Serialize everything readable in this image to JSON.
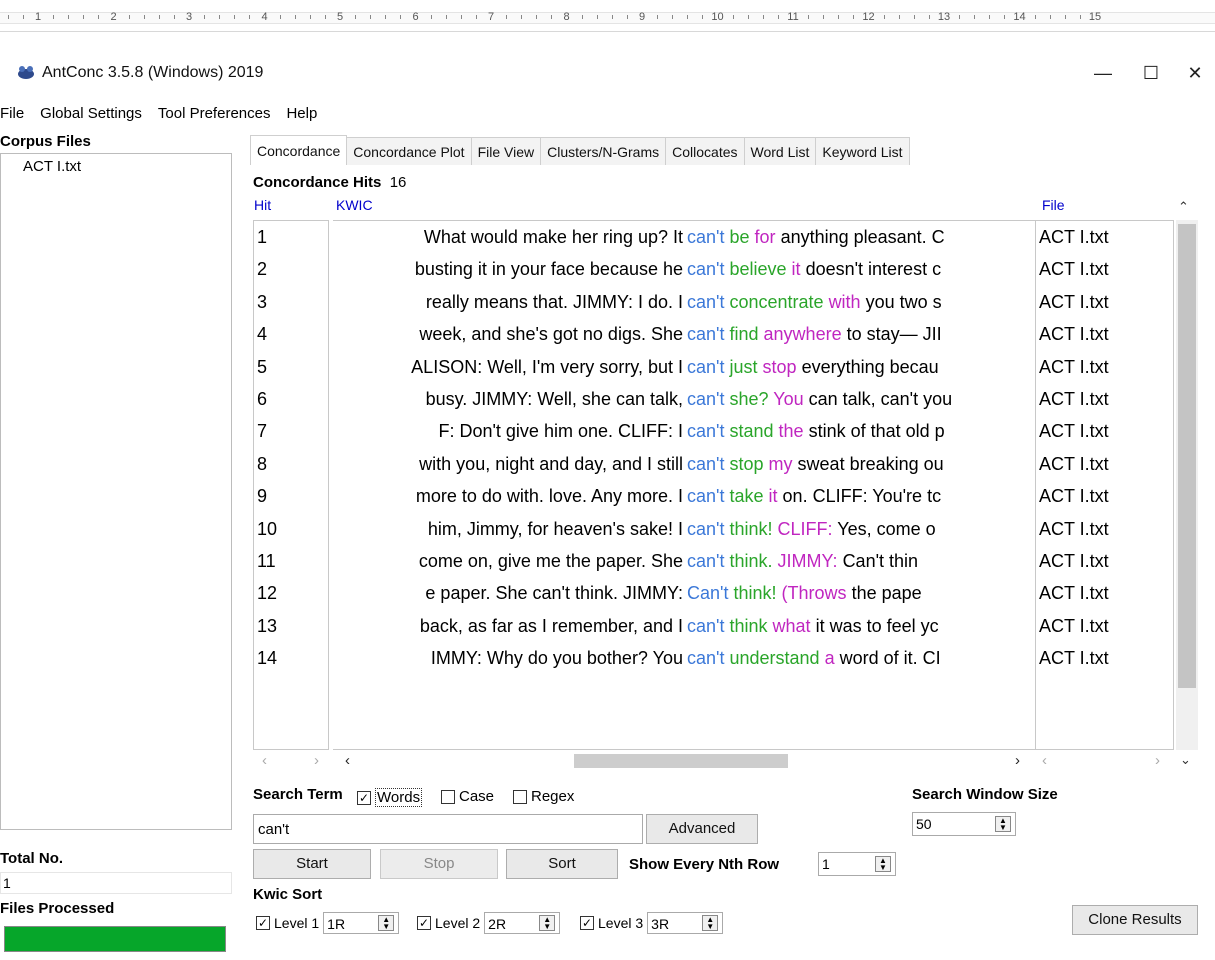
{
  "ruler": {
    "numbers": [
      "1",
      "2",
      "3",
      "4",
      "5",
      "6",
      "7",
      "8",
      "9",
      "10",
      "11",
      "12",
      "13",
      "14",
      "15"
    ]
  },
  "window": {
    "title": "AntConc 3.5.8 (Windows) 2019",
    "minimize": "—",
    "maximize": "☐",
    "close": "✕"
  },
  "menu": {
    "items": [
      "File",
      "Global Settings",
      "Tool Preferences",
      "Help"
    ]
  },
  "sidebar": {
    "corpus_label": "Corpus Files",
    "files": [
      "ACT I.txt"
    ],
    "total_label": "Total No.",
    "total_value": "1",
    "files_processed_label": "Files Processed",
    "progress": 1.0
  },
  "tabs": [
    "Concordance",
    "Concordance Plot",
    "File View",
    "Clusters/N-Grams",
    "Collocates",
    "Word List",
    "Keyword List"
  ],
  "concordance": {
    "hits_label": "Concordance Hits",
    "hits_count": "16",
    "col_hit": "Hit",
    "col_kwic": "KWIC",
    "col_file": "File",
    "rows": [
      {
        "hit": "1",
        "left": "What would make her ring up? It",
        "kw": "can't",
        "r1": "be",
        "r2": "for",
        "rest": "anything pleasant. C",
        "file": "ACT I.txt"
      },
      {
        "hit": "2",
        "left": "busting it in your face because he",
        "kw": "can't",
        "r1": "believe",
        "r2": "it",
        "rest": "doesn't interest c",
        "file": "ACT I.txt"
      },
      {
        "hit": "3",
        "left": "really means that. JIMMY: I    do. I",
        "kw": "can't",
        "r1": "concentrate",
        "r2": "with",
        "rest": "you two s",
        "file": "ACT I.txt"
      },
      {
        "hit": "4",
        "left": "week, and she's got no digs. She",
        "kw": "can't",
        "r1": "find",
        "r2": "anywhere",
        "rest": "to stay— JII",
        "file": "ACT I.txt"
      },
      {
        "hit": "5",
        "left": "ALISON: Well, I'm very sorry, but I",
        "kw": "can't",
        "r1": "just",
        "r2": "stop",
        "rest": "everything becau",
        "file": "ACT I.txt"
      },
      {
        "hit": "6",
        "left": "busy. JIMMY: Well, she can talk,",
        "kw": "can't",
        "r1": "she?",
        "r2": "You",
        "rest": "can talk, can't you",
        "file": "ACT I.txt"
      },
      {
        "hit": "7",
        "left": "F: Don't    give him one. CLIFF: I",
        "kw": "can't",
        "r1": "stand",
        "r2": "the",
        "rest": "stink of that old p",
        "file": "ACT I.txt"
      },
      {
        "hit": "8",
        "left": "with you, night and day, and I still",
        "kw": "can't",
        "r1": "stop",
        "r2": "my",
        "rest": "sweat breaking ou",
        "file": "ACT I.txt"
      },
      {
        "hit": "9",
        "left": "more to do with. love. Any more. I",
        "kw": "can't",
        "r1": "take",
        "r2": "it",
        "rest": "on. CLIFF: You're    tc",
        "file": "ACT I.txt"
      },
      {
        "hit": "10",
        "left": "him, Jimmy, for heaven's sake! I",
        "kw": "can't",
        "r1": "think!",
        "r2": "CLIFF:",
        "rest": "Yes,    come o",
        "file": "ACT I.txt"
      },
      {
        "hit": "11",
        "left": "come on, give me the paper. She",
        "kw": "can't",
        "r1": "think.",
        "r2": "JIMMY:",
        "rest": "Can't     thin",
        "file": "ACT I.txt"
      },
      {
        "hit": "12",
        "left": "e paper. She can't think. JIMMY:",
        "kw": "Can't",
        "r1": "    think!",
        "r2": "(Throws",
        "rest": "the pape",
        "file": "ACT I.txt"
      },
      {
        "hit": "13",
        "left": "back, as far as I remember, and I",
        "kw": "can't",
        "r1": "think",
        "r2": "what",
        "rest": "it was to feel yc",
        "file": "ACT I.txt"
      },
      {
        "hit": "14",
        "left": "IMMY: Why    do you bother? You",
        "kw": "can't",
        "r1": "understand",
        "r2": "a",
        "rest": "word of it. CI",
        "file": "ACT I.txt"
      }
    ]
  },
  "search": {
    "label": "Search Term",
    "words_label": "Words",
    "case_label": "Case",
    "regex_label": "Regex",
    "value": "can't",
    "advanced": "Advanced",
    "start": "Start",
    "stop": "Stop",
    "sort": "Sort",
    "nth_label": "Show Every Nth Row",
    "nth_value": "1",
    "window_label": "Search Window Size",
    "window_value": "50"
  },
  "kwic_sort": {
    "label": "Kwic Sort",
    "levels": [
      {
        "label": "Level 1",
        "value": "1R"
      },
      {
        "label": "Level 2",
        "value": "2R"
      },
      {
        "label": "Level 3",
        "value": "3R"
      }
    ]
  },
  "clone_results": "Clone Results"
}
